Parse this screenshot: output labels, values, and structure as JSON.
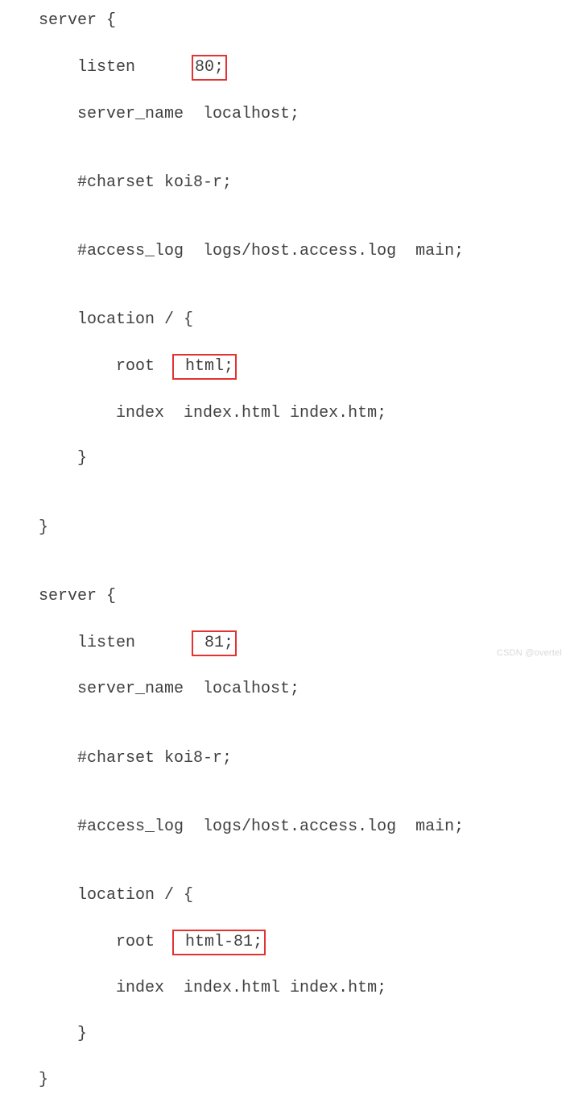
{
  "code": {
    "s1": {
      "open": "    server {",
      "listen_pre": "        listen      ",
      "listen_val": "80;",
      "server_name": "        server_name  localhost;",
      "blank1": "",
      "charset": "        #charset koi8-r;",
      "blank2": "",
      "access_log": "        #access_log  logs/host.access.log  main;",
      "blank3": "",
      "loc_open": "        location / {",
      "root_pre": "            root  ",
      "root_val": " html;",
      "index": "            index  index.html index.htm;",
      "loc_close": "        }",
      "blank4": "",
      "close": "    }"
    },
    "gap": "",
    "s2": {
      "open": "    server {",
      "listen_pre": "        listen      ",
      "listen_val": " 81;",
      "server_name": "        server_name  localhost;",
      "blank1": "",
      "charset": "        #charset koi8-r;",
      "blank2": "",
      "access_log": "        #access_log  logs/host.access.log  main;",
      "blank3": "",
      "loc_open": "        location / {",
      "root_pre": "            root  ",
      "root_val": " html-81;",
      "index": "            index  index.html index.htm;",
      "loc_close": "        }",
      "close": "    }"
    }
  },
  "watermark": "CSDN @overtel"
}
